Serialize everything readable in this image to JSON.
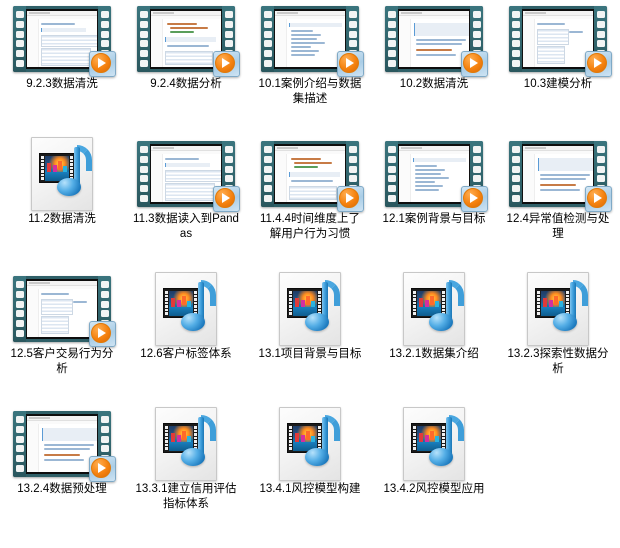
{
  "view": {
    "name": "file-explorer-thumbnail-grid",
    "columns": 5,
    "item_count": 19
  },
  "icons": {
    "video_thumbnail": "video-filmstrip-thumbnail-icon",
    "play_overlay": "play-button-overlay-icon",
    "media_file": "media-file-music-note-icon",
    "page_fold": "page-fold-corner-icon"
  },
  "colors": {
    "filmstrip_border": "#2f6068",
    "play_button": "#f5820f",
    "play_plate": "#aacde6",
    "music_note": "#1f7cc0",
    "page_face": "#f4f4f4",
    "label_text": "#000000",
    "background": "#ffffff"
  },
  "items": [
    {
      "label": "9.2.3数据清洗",
      "type": "video"
    },
    {
      "label": "9.2.4数据分析",
      "type": "video"
    },
    {
      "label": "10.1案例介绍与数据集描述",
      "type": "video"
    },
    {
      "label": "10.2数据清洗",
      "type": "video"
    },
    {
      "label": "10.3建模分析",
      "type": "video"
    },
    {
      "label": "11.2数据清洗",
      "type": "media-file"
    },
    {
      "label": "11.3数据读入到Pandas",
      "type": "video"
    },
    {
      "label": "11.4.4时间维度上了解用户行为习惯",
      "type": "video"
    },
    {
      "label": "12.1案例背景与目标",
      "type": "video"
    },
    {
      "label": "12.4异常值检测与处理",
      "type": "video"
    },
    {
      "label": "12.5客户交易行为分析",
      "type": "video"
    },
    {
      "label": "12.6客户标签体系",
      "type": "media-file"
    },
    {
      "label": "13.1项目背景与目标",
      "type": "media-file"
    },
    {
      "label": "13.2.1数据集介绍",
      "type": "media-file"
    },
    {
      "label": "13.2.3探索性数据分析",
      "type": "media-file"
    },
    {
      "label": "13.2.4数据预处理",
      "type": "video"
    },
    {
      "label": "13.3.1建立信用评估指标体系",
      "type": "media-file"
    },
    {
      "label": "13.4.1风控模型构建",
      "type": "media-file"
    },
    {
      "label": "13.4.2风控模型应用",
      "type": "media-file"
    }
  ]
}
